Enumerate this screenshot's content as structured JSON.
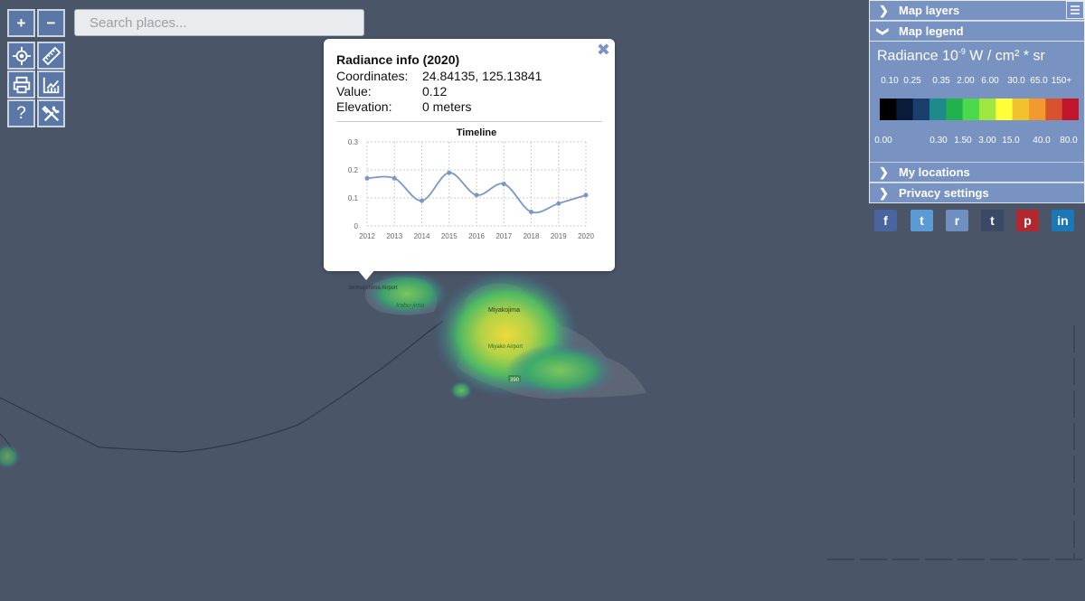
{
  "toolbar": {
    "zoom_in_label": "+",
    "zoom_out_label": "−",
    "help_label": "?"
  },
  "search": {
    "placeholder": "Search places..."
  },
  "map": {
    "labels": [
      "Shimojishima Airport",
      "Irabu-jima",
      "Miyakojima",
      "Miyako Airport",
      "390"
    ]
  },
  "popup": {
    "title": "Radiance info (2020)",
    "rows": [
      {
        "key": "Coordinates:",
        "value": "24.84135, 125.13841"
      },
      {
        "key": "Value:",
        "value": "0.12"
      },
      {
        "key": "Elevation:",
        "value": "0 meters"
      }
    ],
    "close_label": "✖"
  },
  "chart_data": {
    "type": "line",
    "title": "Timeline",
    "x": [
      "2012",
      "2013",
      "2014",
      "2015",
      "2016",
      "2017",
      "2018",
      "2019",
      "2020"
    ],
    "series": [
      {
        "values": [
          0.17,
          0.17,
          0.09,
          0.19,
          0.11,
          0.15,
          0.05,
          0.08,
          0.11
        ]
      }
    ],
    "ylim": [
      0,
      0.3
    ],
    "yticks": [
      "0",
      "0.1",
      "0.2",
      "0.3"
    ],
    "grid": true,
    "color": "#7a98c6"
  },
  "panel": {
    "map_layers": "Map layers",
    "map_legend": "Map legend",
    "legend_unit_prefix": "Radiance 10",
    "legend_unit_exp": "-9",
    "legend_unit_suffix": " W / cm² * sr",
    "top_ticks": [
      "0.10",
      "0.25",
      "0.35",
      "2.00",
      "6.00",
      "30.0",
      "65.0",
      "150+"
    ],
    "bottom_ticks": [
      "0.00",
      "0.30",
      "1.50",
      "3.00",
      "15.0",
      "40.0",
      "80.0"
    ],
    "colors": [
      "#000000",
      "#0a1a3a",
      "#1a3e6e",
      "#1f8a8a",
      "#22b14c",
      "#4cd94c",
      "#a0e640",
      "#ffff3a",
      "#f2c12e",
      "#f29a2e",
      "#d9522e",
      "#c0152a"
    ],
    "my_locations": "My locations",
    "privacy_settings": "Privacy settings"
  },
  "social": [
    {
      "name": "facebook-icon",
      "glyph": "f",
      "color": "#4a64a0"
    },
    {
      "name": "twitter-icon",
      "glyph": "t",
      "color": "#5a9bd5"
    },
    {
      "name": "reddit-icon",
      "glyph": "r",
      "color": "#6f8fc0"
    },
    {
      "name": "tumblr-icon",
      "glyph": "t",
      "color": "#3a4a66"
    },
    {
      "name": "pinterest-icon",
      "glyph": "p",
      "color": "#b3272f"
    },
    {
      "name": "linkedin-icon",
      "glyph": "in",
      "color": "#1b77b5"
    }
  ]
}
